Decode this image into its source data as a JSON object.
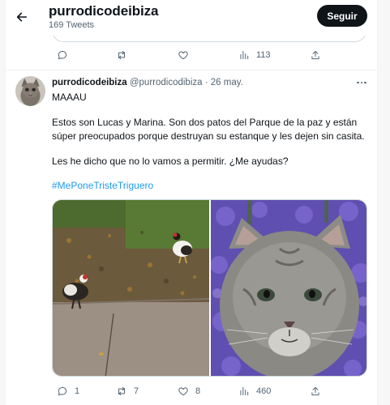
{
  "header": {
    "title": "purrodicodeibiza",
    "subtitle": "169 Tweets",
    "follow_label": "Seguir"
  },
  "previous_tweet": {
    "stats": {
      "views": "113"
    }
  },
  "tweet": {
    "display_name": "purrodicodeibiza",
    "handle": "@purrodicodibiza",
    "separator": " · ",
    "date": "26 may.",
    "line1": "MAAAU",
    "para1_line1": "Estos son Lucas y Marina. Son dos patos del Parque de la paz y están",
    "para1_line2": "súper preocupados porque destruyan su estanque y les dejen sin casita.",
    "para2": "Les he dicho que no lo vamos a permitir. ¿Me ayudas?",
    "hashtag": "#MePoneTristeTriguero",
    "stats": {
      "replies": "1",
      "retweets": "7",
      "likes": "8",
      "views": "460"
    }
  },
  "icons": {
    "back": "arrow-left-icon",
    "reply": "speech-bubble-icon",
    "retweet": "retweet-arrows-icon",
    "like": "heart-icon",
    "views": "bar-chart-icon",
    "share": "share-upload-icon",
    "more": "ellipsis-icon"
  },
  "colors": {
    "accent": "#1d9bf0",
    "text": "#0f1419",
    "muted": "#536471",
    "follow_button": "#0f1419"
  }
}
